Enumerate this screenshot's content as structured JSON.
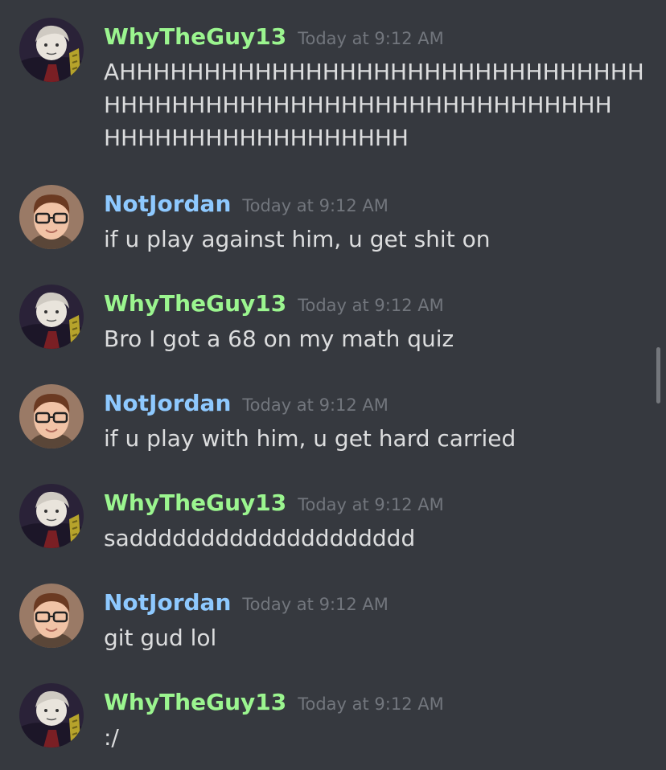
{
  "messages": [
    {
      "author": "WhyTheGuy13",
      "timestamp": "Today at 9:12 AM",
      "lines": [
        "AHHHHHHHHHHHHHHHHHHHHHHHHHHHHHHH",
        "HHHHHHHHHHHHHHHHHHHHHHHHHHHHHH",
        "HHHHHHHHHHHHHHHHHH"
      ]
    },
    {
      "author": "NotJordan",
      "timestamp": "Today at 9:12 AM",
      "text": "if u play against him, u get shit on"
    },
    {
      "author": "WhyTheGuy13",
      "timestamp": "Today at 9:12 AM",
      "text": "Bro I got a 68 on my math quiz"
    },
    {
      "author": "NotJordan",
      "timestamp": "Today at 9:12 AM",
      "text": "if u play with him, u get hard carried"
    },
    {
      "author": "WhyTheGuy13",
      "timestamp": "Today at 9:12 AM",
      "text": "sadddddddddddddddddddd"
    },
    {
      "author": "NotJordan",
      "timestamp": "Today at 9:12 AM",
      "text": "git gud lol"
    },
    {
      "author": "WhyTheGuy13",
      "timestamp": "Today at 9:12 AM",
      "text": ":/"
    }
  ],
  "colors": {
    "background": "#36393f",
    "username_whytheguy": "#9bf58f",
    "username_notjordan": "#8ec9ff",
    "timestamp": "#72767d",
    "message_text": "#dcddde"
  },
  "icons": {
    "whytheguy_avatar": "anime-character-avatar",
    "notjordan_avatar": "boy-with-glasses-avatar"
  }
}
